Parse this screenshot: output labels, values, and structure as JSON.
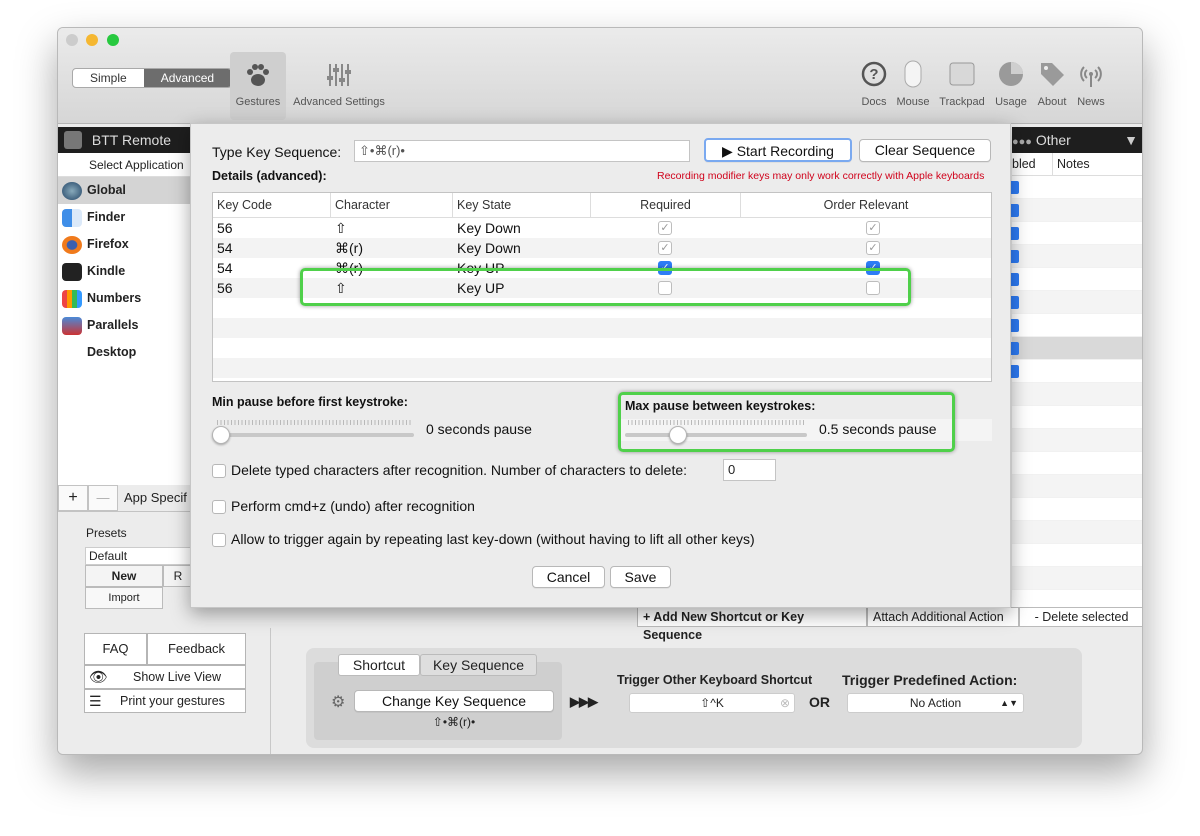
{
  "toolbar": {
    "mode_simple": "Simple",
    "mode_advanced": "Advanced",
    "left_buttons": [
      {
        "label": "Gestures",
        "icon": "paw-icon"
      },
      {
        "label": "Advanced Settings",
        "icon": "sliders-icon"
      }
    ],
    "right_buttons": [
      {
        "label": "Docs",
        "icon": "question-icon"
      },
      {
        "label": "Mouse",
        "icon": "mouse-icon"
      },
      {
        "label": "Trackpad",
        "icon": "trackpad-icon"
      },
      {
        "label": "Usage",
        "icon": "pie-chart-icon"
      },
      {
        "label": "About",
        "icon": "tag-icon"
      },
      {
        "label": "News",
        "icon": "broadcast-icon"
      }
    ]
  },
  "darkbar": {
    "left_label": "BTT Remote",
    "right_label": "Other"
  },
  "sidebar": {
    "header": "Select Application",
    "apps": [
      {
        "name": "Global",
        "selected": true
      },
      {
        "name": "Finder"
      },
      {
        "name": "Firefox"
      },
      {
        "name": "Kindle"
      },
      {
        "name": "Numbers"
      },
      {
        "name": "Parallels Desktop"
      }
    ],
    "add": "+",
    "remove": "—",
    "app_specific": "App Specif"
  },
  "presets": {
    "title": "Presets",
    "default": "Default",
    "new": "New",
    "r": "R",
    "import": "Import"
  },
  "help": {
    "faq": "FAQ",
    "feedback": "Feedback",
    "live_view": "Show Live View",
    "print": "Print your gestures"
  },
  "right_columns": {
    "enabled": "bled",
    "notes": "Notes"
  },
  "actions": {
    "add": "+ Add New Shortcut or Key Sequence",
    "attach": "Attach Additional Action",
    "delete": "- Delete selected"
  },
  "bottom": {
    "tab_shortcut": "Shortcut",
    "tab_sequence": "Key Sequence",
    "change_button": "Change Key Sequence",
    "sequence_display": "⇧•⌘(r)•",
    "arrows": "▶▶▶",
    "trigger_other_title": "Trigger Other Keyboard Shortcut",
    "shortcut_value": "⇧^K",
    "or": "OR",
    "predefined_title": "Trigger Predefined Action:",
    "predefined_value": "No Action"
  },
  "sheet": {
    "type_label": "Type Key Sequence:",
    "sequence_value": "⇧•⌘(r)•",
    "start_recording": "▶ Start Recording",
    "clear_sequence": "Clear Sequence",
    "details": "Details (advanced):",
    "warning": "Recording modifier keys may only work correctly with Apple keyboards",
    "columns": [
      "Key Code",
      "Character",
      "Key State",
      "Required",
      "Order Relevant"
    ],
    "rows": [
      {
        "code": "56",
        "char": "⇧",
        "state": "Key Down",
        "required": true,
        "order": true,
        "blue": false
      },
      {
        "code": "54",
        "char": "⌘(r)",
        "state": "Key Down",
        "required": true,
        "order": true,
        "blue": false
      },
      {
        "code": "54",
        "char": "⌘(r)",
        "state": "Key UP",
        "required": true,
        "order": true,
        "blue": true
      },
      {
        "code": "56",
        "char": "⇧",
        "state": "Key UP",
        "required": false,
        "order": false,
        "blue": false
      }
    ],
    "min_pause_title": "Min pause before first keystroke:",
    "min_pause_value": "0 seconds pause",
    "min_pause_level": 0,
    "max_pause_title": "Max pause between keystrokes:",
    "max_pause_value": "0.5 seconds pause",
    "max_pause_level": 0.27,
    "delete_option": "Delete typed characters after recognition. Number of characters to delete:",
    "delete_count": "0",
    "undo_option": "Perform cmd+z (undo) after recognition",
    "retrigger_option": "Allow to trigger again by repeating last key-down (without having to lift all other keys)",
    "cancel": "Cancel",
    "save": "Save"
  },
  "colors": {
    "highlight": "#4fd04a",
    "accent": "#2e7cf6",
    "warning": "#d0021b"
  }
}
